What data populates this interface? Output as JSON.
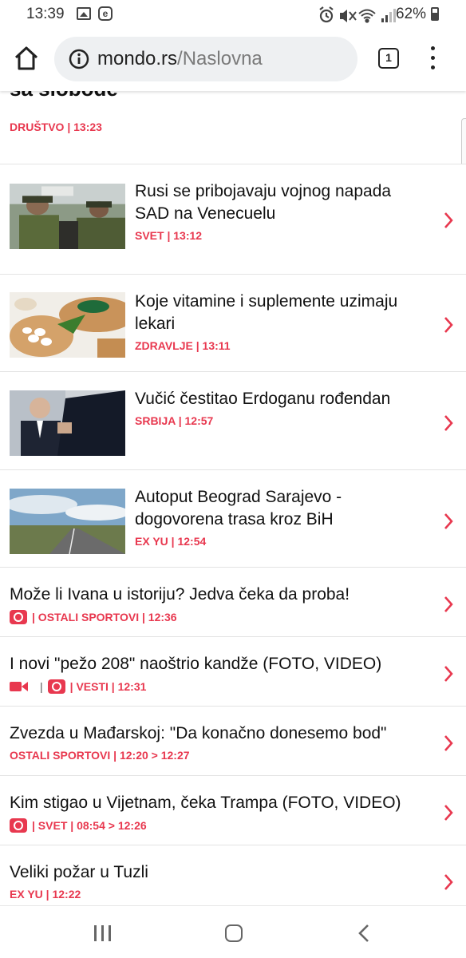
{
  "status_bar": {
    "time": "13:39",
    "battery": "62%"
  },
  "browser": {
    "domain": "mondo.rs",
    "path": "/Naslovna",
    "tab_count": "1"
  },
  "partial_article": {
    "title": "sa slobode",
    "meta": "DRUŠTVO | 13:23"
  },
  "articles": [
    {
      "title": "Rusi se pribojavaju vojnog napada SAD na Venecuelu",
      "meta": "SVET | 13:12"
    },
    {
      "title": "Koje vitamine i suplemente uzimaju lekari",
      "meta": "ZDRAVLJE | 13:11"
    },
    {
      "title": "Vučić čestitao Erdoganu rođendan",
      "meta": "SRBIJA | 12:57"
    },
    {
      "title": "Autoput Beograd Sarajevo - dogovorena trasa kroz BiH",
      "meta": "EX YU | 12:54"
    },
    {
      "title": "Može li Ivana u istoriju? Jedva čeka da proba!",
      "meta": "| OSTALI SPORTOVI | 12:36"
    },
    {
      "title": "I novi \"pežo 208\" naoštrio kandže (FOTO, VIDEO)",
      "meta": "| VESTI | 12:31"
    },
    {
      "title": "Zvezda u Mađarskoj: \"Da konačno donesemo bod\"",
      "meta": "OSTALI SPORTOVI | 12:20 > 12:27"
    },
    {
      "title": "Kim stigao u Vijetnam, čeka Trampa (FOTO, VIDEO)",
      "meta": "| SVET | 08:54 > 12:26"
    },
    {
      "title": "Veliki požar u Tuzli",
      "meta": "EX YU | 12:22"
    }
  ],
  "colors": {
    "accent": "#e8384f",
    "text": "#111111",
    "divider": "#e3e3e3"
  }
}
